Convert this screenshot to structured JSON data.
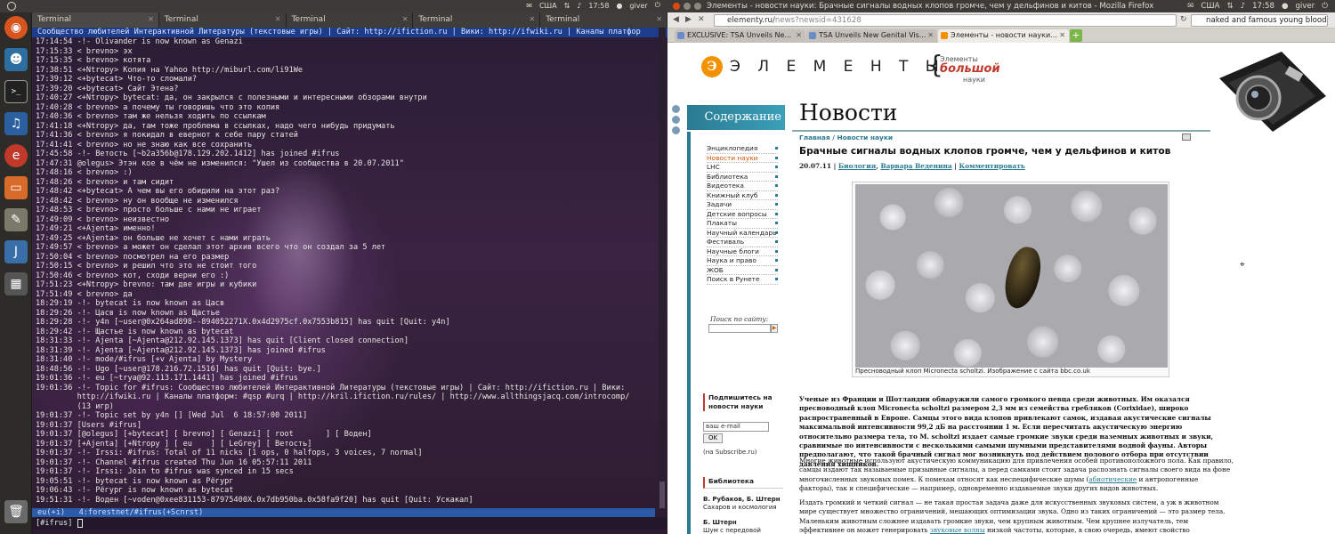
{
  "system": {
    "layout": "США",
    "time": "17:58",
    "user": "giver"
  },
  "terminal": {
    "tabs": [
      "Terminal",
      "Terminal",
      "Terminal",
      "Terminal",
      "Terminal"
    ],
    "topic": "Сообщество любителей Интерактивной Литературы (текстовые игры) | Сайт: http://ifiction.ru | Вики: http://ifwiki.ru | Каналы платфор",
    "lines": [
      "17:14:54 -!- Olivander is now known as Genazi",
      "17:15:33 < brevno> эх",
      "17:15:35 < brevno> котята",
      "17:38:51 <+Ntropy> Копия на Yahoo http://miburl.com/li91We",
      "17:39:12 <+bytecat> Что-то сломали?",
      "17:39:20 <+bytecat> Сайт Этена?",
      "17:40:27 <+Ntropy> bytecat: да, он закрылся с полезными и интересными обзорами внутри",
      "17:40:28 < brevno> а почему ты говоришь что это копия",
      "17:40:36 < brevno> там же нельзя ходить по ссылкам",
      "17:41:18 <+Ntropy> да, там тоже проблема в ссылках, надо чего нибудь придумать",
      "17:41:36 < brevno> я покидал в евернот к себе пару статей",
      "17:41:41 < brevno> но не знаю как все сохранить",
      "17:45:58 -!- Ветость [~b2a356b@178.129.202.1412] has joined #ifrus",
      "17:47:31 @olegus> Этэн кое в чём не изменился: \"Ушел из сообщества в 20.07.2011\"",
      "17:48:16 < brevno> :)",
      "17:48:26 < brevno> и там сидит",
      "17:48:42 <+bytecat> А чем вы его обидили на этот раз?",
      "17:48:42 < brevno> ну он вообще не изменился",
      "17:48:53 < brevno> просто больше с нами не играет",
      "17:49:09 < brevno> неизвестно",
      "17:49:21 <+Ajenta> именно!",
      "17:49:25 <+Ajenta> он больше не хочет с нами играть",
      "17:49:57 < brevno> а может он сделал этот архив всего что он создал за 5 лет",
      "17:50:04 < brevno> посмотрел на его размер",
      "17:50:15 < brevno> и решил что это не стоит того",
      "17:50:46 < brevno> кот, сходи верни его :)",
      "17:51:23 <+Ntropy> brevno: там две игры и кубики",
      "17:51:49 < brevno> да",
      "18:29:19 -!- bytecat is now known as Цасв",
      "18:29:26 -!- Цасв is now known as Щастье",
      "18:29:28 -!- y4n [~user@0x264ad898--894052271X.0x4d2975cf.0x7553b815] has quit [Quit: y4n]",
      "18:29:42 -!- Щастье is now known as bytecat",
      "18:31:33 -!- Ajenta [~Ajenta@212.92.145.1373] has quit [Client closed connection]",
      "18:31:39 -!- Ajenta [~Ajenta@212.92.145.1373] has joined #ifrus",
      "18:31:40 -!- mode/#ifrus [+v Ajenta] by Mystery",
      "18:48:56 -!- Ugo [~user@178.216.72.1516] has quit [Quit: bye.]",
      "19:01:36 -!- eu [~trya@92.113.171.1441] has joined #ifrus",
      "19:01:36 -!- Topic for #ifrus: Сообщество любителей Интерактивной Литературы (текстовые игры) | Сайт: http://ifiction.ru | Вики:",
      "         http://ifwiki.ru | Каналы платформ: #qsp #urq | http://kril.ifiction.ru/rules/ | http://www.allthingsjacq.com/introcomp/",
      "         (13 игр)",
      "19:01:37 -!- Topic set by y4n [] [Wed Jul  6 18:57:00 2011]",
      "19:01:37 [Users #ifrus]",
      "19:01:37 [@olegus] [+bytecat] [ brevno] [ Genazi] [ root       ] [ Воден]",
      "19:01:37 [+Ajenta] [+Ntropy ] [ eu    ] [ LeGrey] [ Ветость]",
      "19:01:37 -!- Irssi: #ifrus: Total of 11 nicks [1 ops, 0 halfops, 3 voices, 7 normal]",
      "19:01:37 -!- Channel #ifrus created Thu Jun 16 05:57:11 2011",
      "19:01:37 -!- Irssi: Join to #ifrus was synced in 15 secs",
      "19:05:51 -!- bytecat is now known as Pёгург",
      "19:06:43 -!- Pёгург is now known as bytecat",
      "19:51:31 -!- Воден [~voden@0xee831153-87975400X.0x7db950ba.0x58fa9f20] has quit [Quit: Ускакал]"
    ],
    "status": "eu(+i)   4:forestnet/#ifrus(+Scnrst)",
    "prompt": "[#ifrus] "
  },
  "firefox": {
    "window_title": "Элементы - новости науки: Брачные сигналы водных клопов громче, чем у дельфинов и китов - Mozilla Firefox",
    "url_host": "elementy.ru/",
    "url_path": "news?newsid=431628",
    "search": "naked and famous young blood",
    "tabs": [
      {
        "label": "EXCLUSIVE: TSA Unveils Ne...",
        "active": false
      },
      {
        "label": "TSA Unveils New Genital Vis...",
        "active": false
      },
      {
        "label": "Элементы - новости науки...",
        "active": true
      }
    ]
  },
  "site": {
    "logo_letters": "Э Л Е М Е Н Т Ы",
    "logo_orb": "Э",
    "big_t1": "Элементы",
    "big_t2": "большой",
    "big_t3": "науки",
    "contents_label": "Содержание",
    "section_heading": "Новости",
    "menu": [
      "Энциклопедия",
      "Новости науки",
      "LHC",
      "Библиотека",
      "Видеотека",
      "Книжный клуб",
      "Задачи",
      "Детские вопросы",
      "Плакаты",
      "Научный календарь",
      "Фестиваль",
      "Научные блоги",
      "Наука и право",
      "ЖОБ",
      "Поиск в Рунете"
    ],
    "search_label": "Поиск по сайту:",
    "subscribe_heading": "Подпишитесь на новости науки",
    "email_placeholder": "ваш e-mail",
    "ok_label": "OK",
    "via": "(на Subscribe.ru)",
    "library_heading": "Библиотека",
    "book1_author": "В. Рубаков, Б. Штерн",
    "book1_title": "Сахаров и космология",
    "book2_author": "Б. Штерн",
    "book2_title": "Шум с передовой"
  },
  "article": {
    "crumb_home": "Главная",
    "crumb_sep": " / ",
    "crumb_section": "Новости науки",
    "title": "Брачные сигналы водных клопов громче, чем у дельфинов и китов",
    "date": "20.07.11",
    "sep1": " | ",
    "topic": "Биология",
    "sep2": ", ",
    "author": "Варвара Веденина",
    "sep3": " | ",
    "comment": "Комментировать",
    "caption": "Пресноводный клоп Micronecta scholtzi. Изображение с сайта bbc.co.uk",
    "lead": "Ученые из Франции и Шотландии обнаружили самого громкого певца среди животных. Им оказался пресноводный клоп Micronecta scholtzi размером 2,3 мм из семейства гребляков (Corixidae), широко распространенный в Европе. Самцы этого вида клопов привлекают самок, издавая акустические сигналы максимальной интенсивности 99,2 дБ на расстоянии 1 м. Если пересчитать акустическую энергию относительно размера тела, то M. scholtzi издает самые громкие звуки среди наземных животных и звуки, сравнимые по интенсивности с несколькими самыми шумными представителями водной фауны. Авторы предполагают, что такой брачный сигнал мог возникнуть под действием полового отбора при отсутствии давления хищников.",
    "p1_a": "Многие животные используют акустическую коммуникацию для привлечения особей противоположного пола. Как правило, самцы издают так называемые призывные сигналы, а перед самками стоит задача распознать сигналы своего вида на фоне многочисленных звуковых помех. К помехам относят как неспецифические шумы (",
    "p1_link": "абиотические",
    "p1_b": " и антропогенные факторы), так и специфические — например, одновременно издаваемые звуки других видов животных.",
    "p2_a": "Издать громкий и четкий сигнал — не такая простая задача даже для искусственных звуковых систем, а уж в животном мире существует множество ограничений, мешающих оптимизации звука. Одно из таких ограничений — это размер тела. Маленьким животным сложнее издавать громкие звуки, чем крупным животным. Чем крупнее излучатель, тем эффективнее он может генерировать ",
    "p2_link": "звуковые волны",
    "p2_b": " низкой частоты, которые, в свою очередь, имеют свойство распространяться на большее расстояние, чем"
  }
}
